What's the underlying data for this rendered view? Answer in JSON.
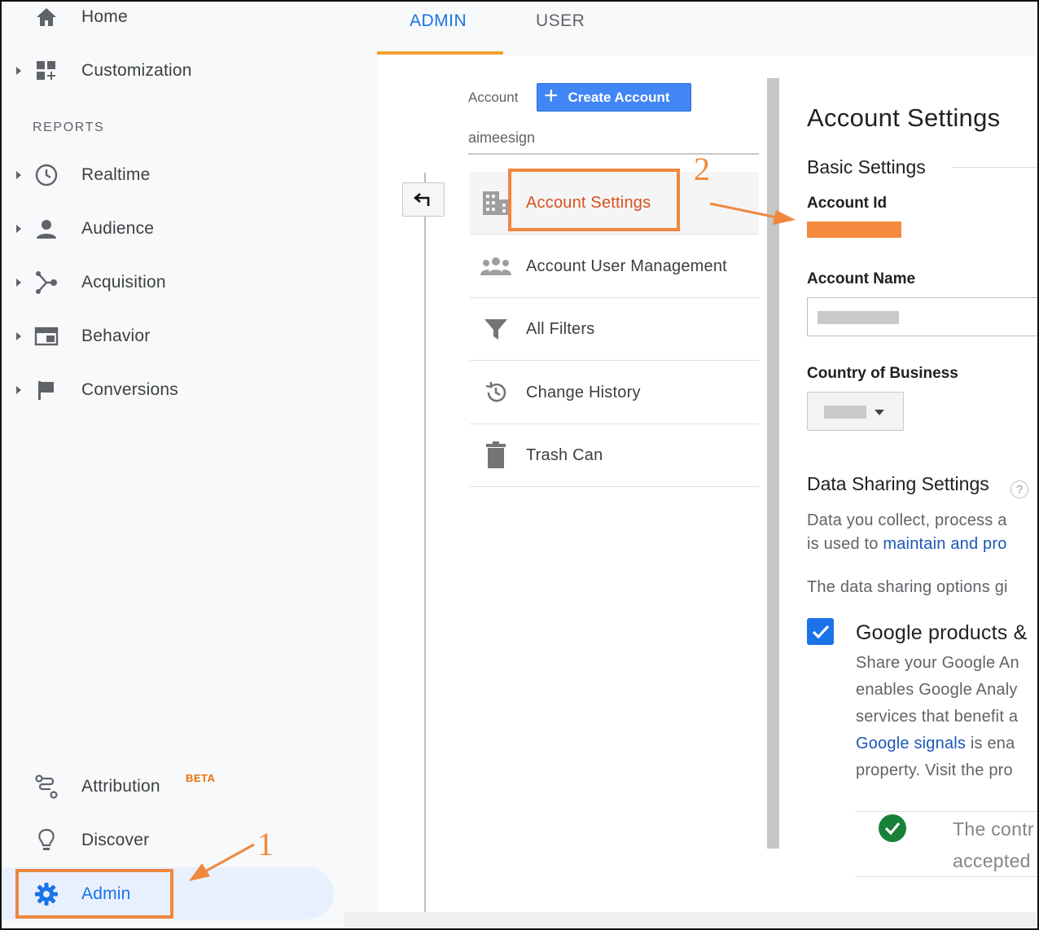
{
  "sidebar": {
    "home": "Home",
    "customization": "Customization",
    "reports_label": "REPORTS",
    "realtime": "Realtime",
    "audience": "Audience",
    "acquisition": "Acquisition",
    "behavior": "Behavior",
    "conversions": "Conversions",
    "attribution": "Attribution",
    "attribution_badge": "BETA",
    "discover": "Discover",
    "admin": "Admin"
  },
  "tabs": {
    "admin": "ADMIN",
    "user": "USER"
  },
  "account_column": {
    "label": "Account",
    "create_button": "Create Account",
    "account_name": "aimeesign",
    "menu": [
      {
        "label": "Account Settings",
        "icon": "building-icon"
      },
      {
        "label": "Account User Management",
        "icon": "group-icon"
      },
      {
        "label": "All Filters",
        "icon": "filter-icon"
      },
      {
        "label": "Change History",
        "icon": "history-icon"
      },
      {
        "label": "Trash Can",
        "icon": "trash-icon"
      }
    ]
  },
  "settings": {
    "title": "Account Settings",
    "basic": "Basic Settings",
    "account_id_label": "Account Id",
    "account_name_label": "Account Name",
    "country_label": "Country of Business",
    "data_sharing_title": "Data Sharing Settings",
    "help": "?",
    "p1_line1": "Data you collect, process a",
    "p1_line2_pre": "is used to ",
    "p1_line2_link": "maintain and pro",
    "p2": "The data sharing options gi",
    "google_products_title": "Google products &",
    "gp_line1": "Share your Google An",
    "gp_line2": "enables Google Analy",
    "gp_line3": "services that benefit a",
    "gp_line4_link": "Google signals",
    "gp_line4_post": " is ena",
    "gp_line5": "property. Visit the pro",
    "contract_line1": "The contr",
    "contract_line2": "accepted"
  },
  "annotations": {
    "step1": "1",
    "step2": "2",
    "color": "#f0873e"
  },
  "colors": {
    "accent_blue": "#1a73e8",
    "button_blue": "#4285f4",
    "highlight_orange": "#d9501f",
    "tab_underline": "#f0a030",
    "success_green": "#188038"
  }
}
